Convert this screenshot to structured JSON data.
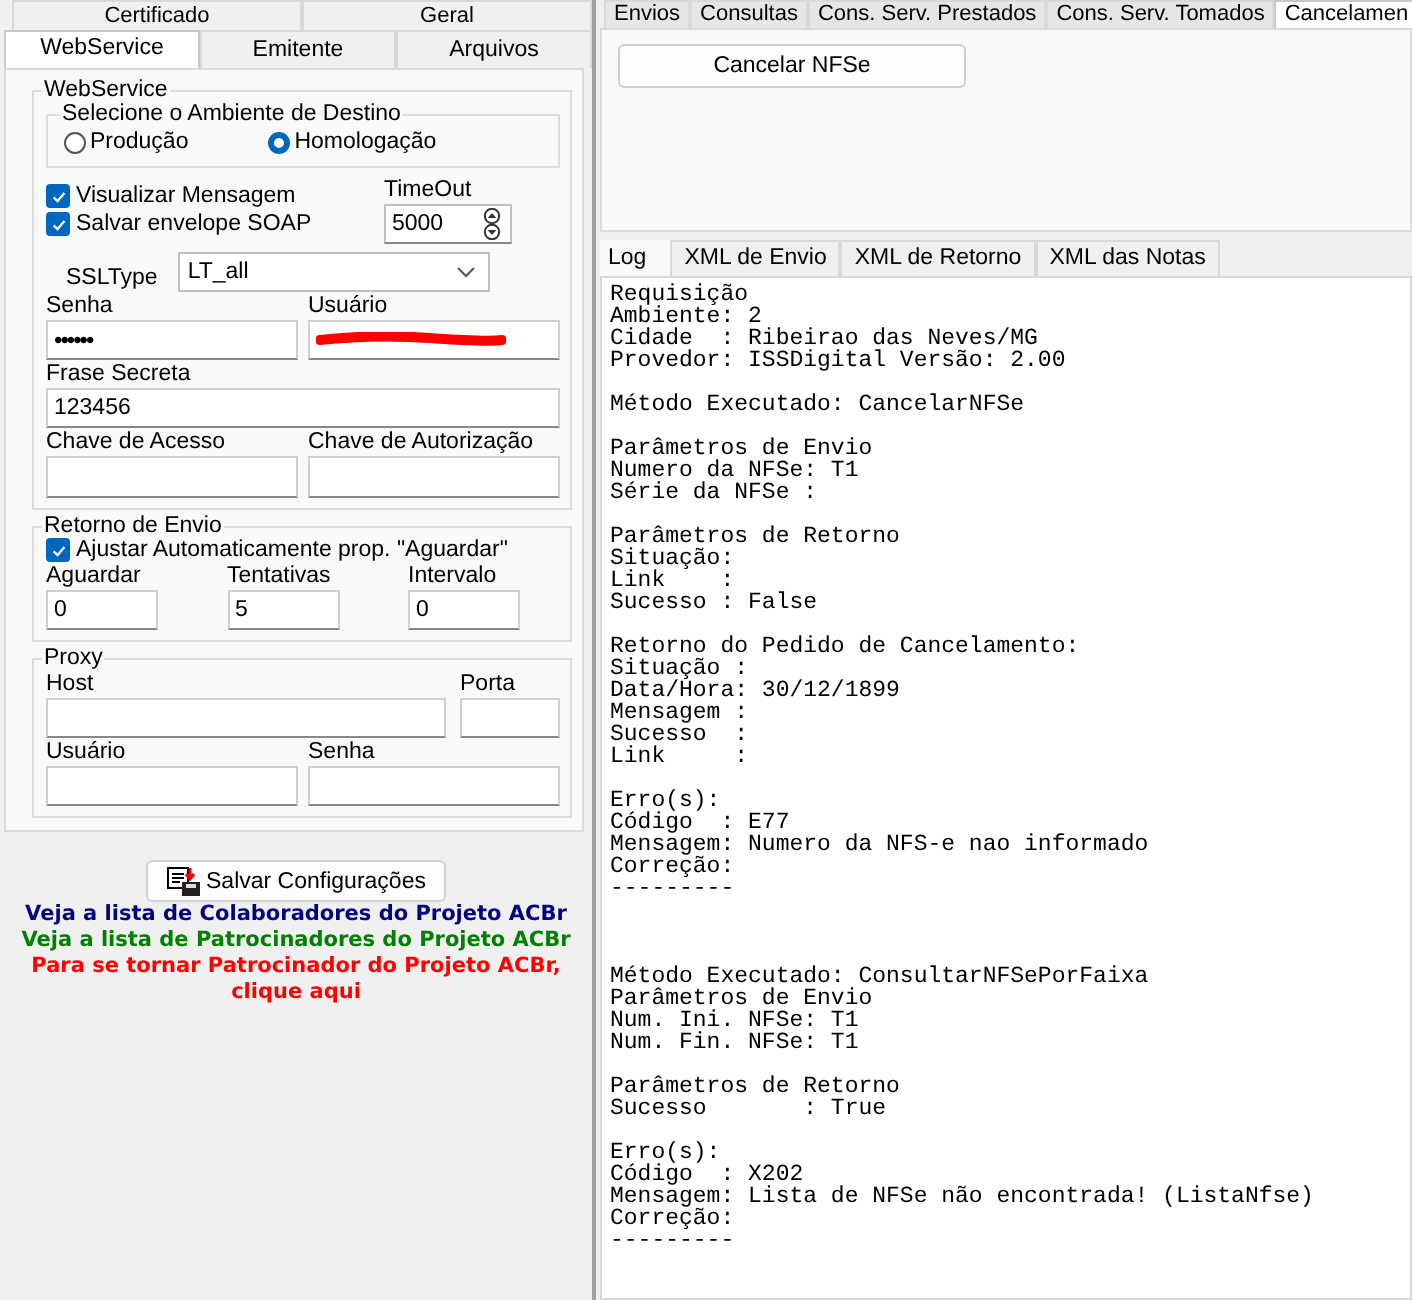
{
  "left_tabs_row1": [
    {
      "label": "Certificado"
    },
    {
      "label": "Geral"
    }
  ],
  "left_tabs_row2": [
    {
      "label": "WebService",
      "selected": true
    },
    {
      "label": "Emitente",
      "selected": false
    },
    {
      "label": "Arquivos",
      "selected": false
    }
  ],
  "webservice": {
    "title": "WebService",
    "ambiente": {
      "title": "Selecione o Ambiente de Destino",
      "options": [
        {
          "label": "Produção",
          "selected": false
        },
        {
          "label": "Homologação",
          "selected": true
        }
      ]
    },
    "checkboxes": [
      {
        "label": "Visualizar Mensagem",
        "checked": true
      },
      {
        "label": "Salvar envelope SOAP",
        "checked": true
      }
    ],
    "timeout": {
      "label": "TimeOut",
      "value": "5000"
    },
    "ssltype": {
      "label": "SSLType",
      "value": "LT_all"
    },
    "senha": {
      "label": "Senha",
      "value": "••••••"
    },
    "usuario": {
      "label": "Usuário",
      "redacted": true
    },
    "frase_secreta": {
      "label": "Frase Secreta",
      "value": "123456"
    },
    "chave_acesso": {
      "label": "Chave de Acesso"
    },
    "chave_autorizacao": {
      "label": "Chave de Autorização"
    }
  },
  "retorno": {
    "title": "Retorno de Envio",
    "ajustar": {
      "label": "Ajustar Automaticamente prop. \"Aguardar\"",
      "checked": true
    },
    "fields": [
      {
        "label": "Aguardar",
        "value": "0"
      },
      {
        "label": "Tentativas",
        "value": "5"
      },
      {
        "label": "Intervalo",
        "value": "0"
      }
    ]
  },
  "proxy": {
    "title": "Proxy",
    "host": {
      "label": "Host"
    },
    "porta": {
      "label": "Porta"
    },
    "usuario": {
      "label": "Usuário"
    },
    "senha": {
      "label": "Senha"
    }
  },
  "save_button": "Salvar Configurações",
  "links": [
    {
      "text": "Veja a lista de Colaboradores do Projeto ACBr",
      "color": "#000080"
    },
    {
      "text": "Veja a lista de Patrocinadores do Projeto ACBr",
      "color": "#008000"
    },
    {
      "text": "Para se tornar Patrocinador do Projeto ACBr, clique aqui",
      "color": "#ff0000"
    }
  ],
  "right_tabs": [
    {
      "label": "Envios",
      "selected": false
    },
    {
      "label": "Consultas",
      "selected": false
    },
    {
      "label": "Cons. Serv. Prestados",
      "selected": false
    },
    {
      "label": "Cons. Serv. Tomados",
      "selected": false
    },
    {
      "label": "Cancelamen",
      "selected": true
    }
  ],
  "cancel_button": "Cancelar NFSe",
  "log_tabs": [
    {
      "label": "Log",
      "selected": true
    },
    {
      "label": "XML de Envio",
      "selected": false
    },
    {
      "label": "XML de Retorno",
      "selected": false
    },
    {
      "label": "XML das Notas",
      "selected": false
    }
  ],
  "log": [
    {
      "kind": "block",
      "lines": [
        "Requisição",
        "Ambiente: 2",
        "Cidade  : Ribeirao das Neves/MG",
        "Provedor: ISSDigital Versão: 2.00"
      ]
    },
    {
      "kind": "block",
      "lines": [
        "Método Executado: CancelarNFSe"
      ]
    },
    {
      "kind": "block",
      "lines": [
        "Parâmetros de Envio",
        "Numero da NFSe: T1",
        "Série da NFSe :"
      ]
    },
    {
      "kind": "block",
      "lines": [
        "Parâmetros de Retorno",
        "Situação:",
        "Link    :",
        "Sucesso : False"
      ]
    },
    {
      "kind": "block",
      "lines": [
        "Retorno do Pedido de Cancelamento:",
        "Situação :",
        "Data/Hora: 30/12/1899",
        "Mensagem :",
        "Sucesso  :",
        "Link     :"
      ]
    },
    {
      "kind": "block",
      "lines": [
        "Erro(s):",
        "Código  : E77",
        "Mensagem: Numero da NFS-e nao informado",
        "Correção:",
        "---------"
      ]
    },
    {
      "kind": "section",
      "lines": [
        "Método Executado: ConsultarNFSePorFaixa",
        "Parâmetros de Envio",
        "Num. Ini. NFSe: T1",
        "Num. Fin. NFSe: T1"
      ]
    },
    {
      "kind": "block",
      "lines": [
        "Parâmetros de Retorno",
        "Sucesso       : True"
      ]
    },
    {
      "kind": "block",
      "lines": [
        "Erro(s):",
        "Código  : X202",
        "Mensagem: Lista de NFSe não encontrada! (ListaNfse)",
        "Correção:",
        "---------"
      ]
    }
  ]
}
